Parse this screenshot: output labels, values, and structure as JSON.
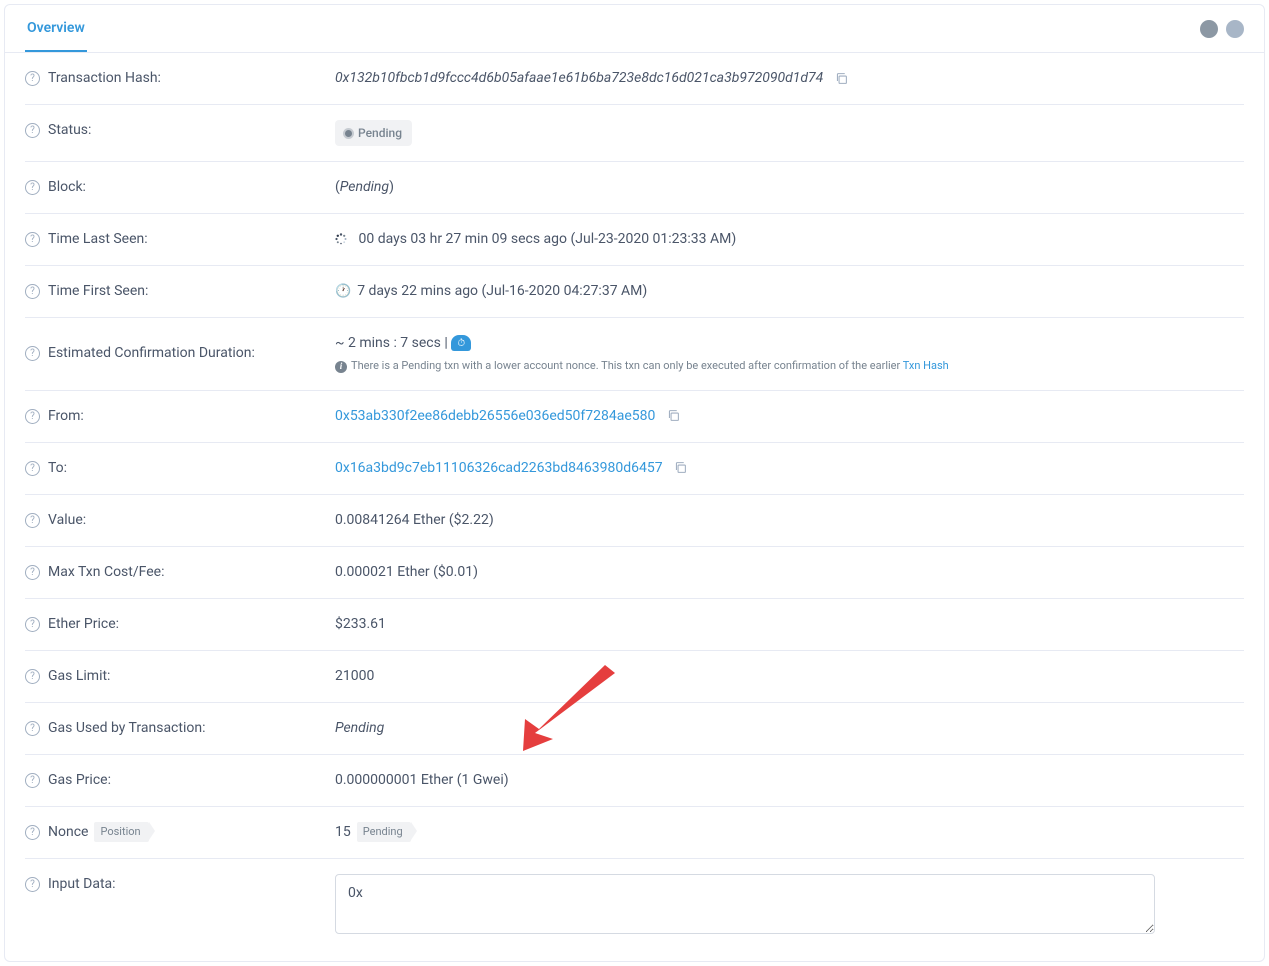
{
  "header": {
    "tab_overview": "Overview"
  },
  "rows": {
    "txhash": {
      "label": "Transaction Hash:",
      "value": "0x132b10fbcb1d9fccc4d6b05afaae1e61b6ba723e8dc16d021ca3b972090d1d74"
    },
    "status": {
      "label": "Status:",
      "badge": "Pending"
    },
    "block": {
      "label": "Block:",
      "value": "Pending"
    },
    "timelast": {
      "label": "Time Last Seen:",
      "value": "00 days 03 hr 27 min 09 secs ago (Jul-23-2020 01:23:33 AM)"
    },
    "timefirst": {
      "label": "Time First Seen:",
      "value": "7 days 22 mins ago (Jul-16-2020 04:27:37 AM)"
    },
    "confirmation": {
      "label": "Estimated Confirmation Duration:",
      "value": "~ 2 mins : 7 secs | ",
      "note_prefix": "There is a Pending txn with a lower account nonce. This txn can only be executed after confirmation of the earlier ",
      "note_link": "Txn Hash"
    },
    "from": {
      "label": "From:",
      "value": "0x53ab330f2ee86debb26556e036ed50f7284ae580"
    },
    "to": {
      "label": "To:",
      "value": "0x16a3bd9c7eb11106326cad2263bd8463980d6457"
    },
    "value": {
      "label": "Value:",
      "value": "0.00841264 Ether ($2.22)"
    },
    "maxcost": {
      "label": "Max Txn Cost/Fee:",
      "value": "0.000021 Ether ($0.01)"
    },
    "etherprice": {
      "label": "Ether Price:",
      "value": "$233.61"
    },
    "gaslimit": {
      "label": "Gas Limit:",
      "value": "21000"
    },
    "gasused": {
      "label": "Gas Used by Transaction:",
      "value": "Pending"
    },
    "gasprice": {
      "label": "Gas Price:",
      "value": "0.000000001 Ether (1 Gwei)"
    },
    "nonce": {
      "label": "Nonce",
      "position": "Position",
      "value": "15",
      "pending": "Pending"
    },
    "inputdata": {
      "label": "Input Data:",
      "value": "0x"
    }
  }
}
